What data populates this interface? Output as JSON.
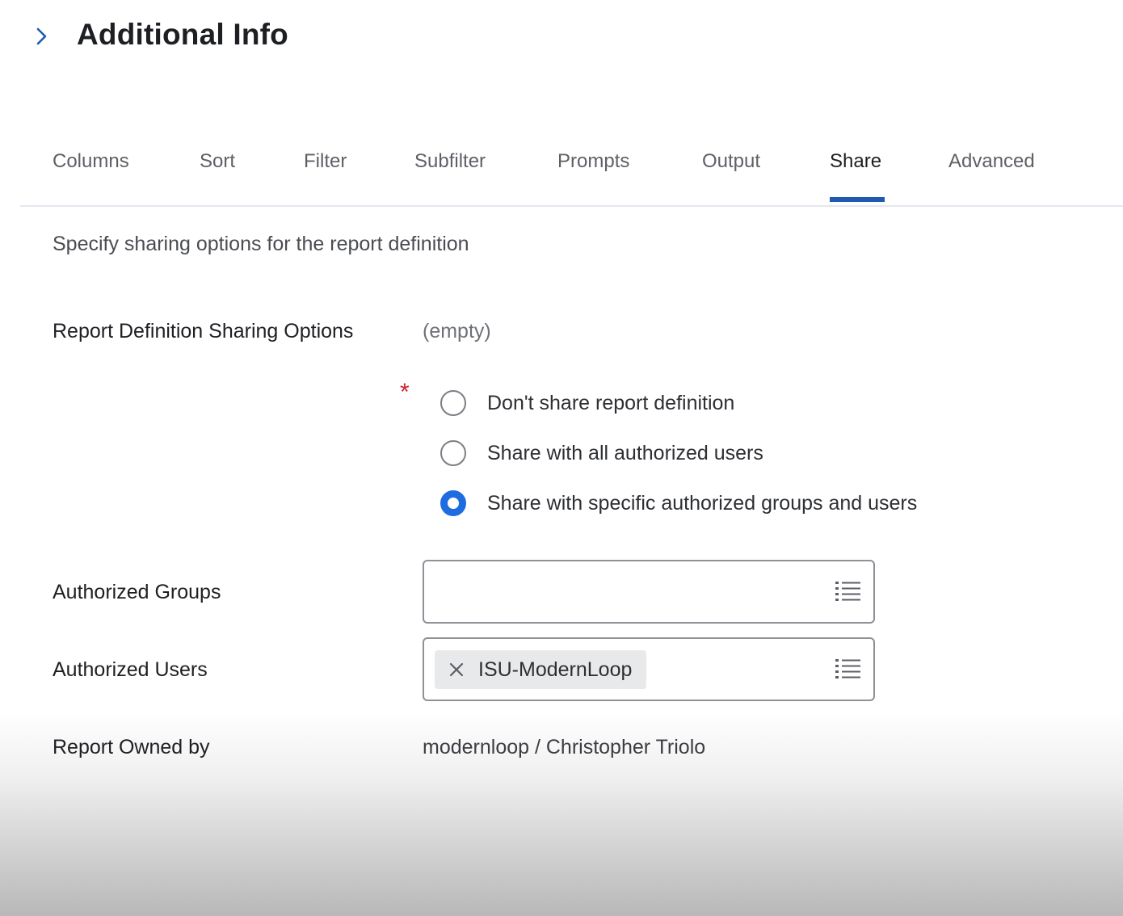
{
  "header": {
    "title": "Additional Info",
    "expand_icon": "chevron-right-icon"
  },
  "tabs": [
    {
      "label": "Columns",
      "active": false
    },
    {
      "label": "Sort",
      "active": false
    },
    {
      "label": "Filter",
      "active": false
    },
    {
      "label": "Subfilter",
      "active": false
    },
    {
      "label": "Prompts",
      "active": false
    },
    {
      "label": "Output",
      "active": false
    },
    {
      "label": "Share",
      "active": true
    },
    {
      "label": "Advanced",
      "active": false
    }
  ],
  "main": {
    "description": "Specify sharing options for the report definition",
    "sharing_options": {
      "label": "Report Definition Sharing Options",
      "value": "(empty)",
      "required_marker": "*",
      "options": [
        {
          "label": "Don't share report definition",
          "selected": false
        },
        {
          "label": "Share with all authorized users",
          "selected": false
        },
        {
          "label": "Share with specific authorized groups and users",
          "selected": true
        }
      ]
    },
    "authorized_groups": {
      "label": "Authorized Groups",
      "value": "",
      "icon": "list-icon"
    },
    "authorized_users": {
      "label": "Authorized Users",
      "selected": [
        "ISU-ModernLoop"
      ],
      "icon": "list-icon",
      "remove_icon": "close-icon"
    },
    "report_owner": {
      "label": "Report Owned by",
      "value": "modernloop / Christopher Triolo"
    }
  },
  "colors": {
    "accent": "#1e5ab0",
    "radio_selected": "#1f6be0",
    "required": "#d1202f"
  }
}
